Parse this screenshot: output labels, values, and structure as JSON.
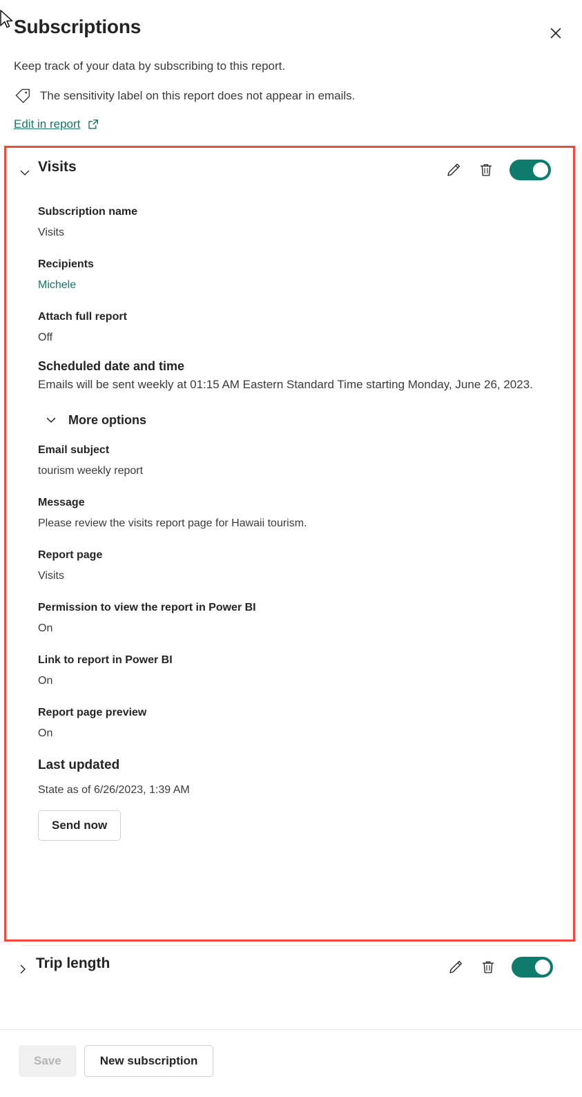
{
  "header": {
    "title": "Subscriptions",
    "close_icon": "close-icon",
    "subtitle": "Keep track of your data by subscribing to this report.",
    "sensitivity_icon": "tag-icon",
    "sensitivity_text": "The sensitivity label on this report does not appear in emails.",
    "edit_link": "Edit in report",
    "external_link_icon": "external-link-icon"
  },
  "colors": {
    "accent_teal": "#0f7b6c",
    "link_teal": "#1a7365",
    "highlight_red": "#f2493c",
    "text_primary": "#242424",
    "text_secondary": "#3b3a39"
  },
  "subscriptions": [
    {
      "name": "Visits",
      "expanded": true,
      "chevron_icon": "chevron-down-icon",
      "edit_icon": "pencil-icon",
      "delete_icon": "trash-icon",
      "toggle_state": "On",
      "fields": {
        "subscription_name_label": "Subscription name",
        "subscription_name_value": "Visits",
        "recipients_label": "Recipients",
        "recipients_value": "Michele",
        "attach_label": "Attach full report",
        "attach_value": "Off",
        "schedule_label": "Scheduled date and time",
        "schedule_value": "Emails will be sent weekly at 01:15 AM Eastern Standard Time starting Monday, June 26, 2023.",
        "more_options_label": "More options",
        "more_options_icon": "chevron-down-icon",
        "email_subject_label": "Email subject",
        "email_subject_value": "tourism weekly report",
        "message_label": "Message",
        "message_value": "Please review the visits report page for Hawaii tourism.",
        "report_page_label": "Report page",
        "report_page_value": "Visits",
        "permission_label": "Permission to view the report in Power BI",
        "permission_value": "On",
        "link_label": "Link to report in Power BI",
        "link_value": "On",
        "preview_label": "Report page preview",
        "preview_value": "On",
        "last_updated_label": "Last updated",
        "last_updated_value": "State as of 6/26/2023, 1:39 AM",
        "send_now_label": "Send now"
      }
    },
    {
      "name": "Trip length",
      "expanded": false,
      "chevron_icon": "chevron-right-icon",
      "edit_icon": "pencil-icon",
      "delete_icon": "trash-icon",
      "toggle_state": "On"
    }
  ],
  "footer": {
    "save_label": "Save",
    "save_disabled": true,
    "new_subscription_label": "New subscription"
  }
}
